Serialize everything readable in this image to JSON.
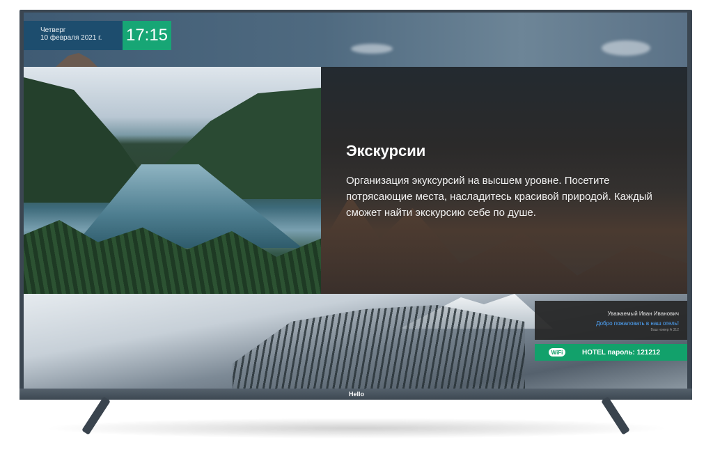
{
  "datetime": {
    "weekday": "Четверг",
    "date": "10 февраля 2021 г.",
    "time": "17:15"
  },
  "slide": {
    "title": "Экскурсии",
    "description": "Организация экуксурсий на высшем уровне. Посетите потрясающие места, насладитесь красивой природой. Каждый сможет найти экскурсию себе по душе."
  },
  "guest": {
    "greeting_name": "Уважаемый Иван Иванович",
    "welcome": "Добро пожаловать в наш отель!",
    "room": "Ваш номер А 312"
  },
  "wifi": {
    "icon": "wifi-icon",
    "icon_label": "WiFi",
    "text": "HOTEL пароль: 121212"
  },
  "tv": {
    "brand": "Hello"
  },
  "colors": {
    "date_bg": "#1d4d6e",
    "time_bg": "#17a675",
    "wifi_bg": "#12a16b",
    "welcome_link": "#4fa7ff"
  }
}
